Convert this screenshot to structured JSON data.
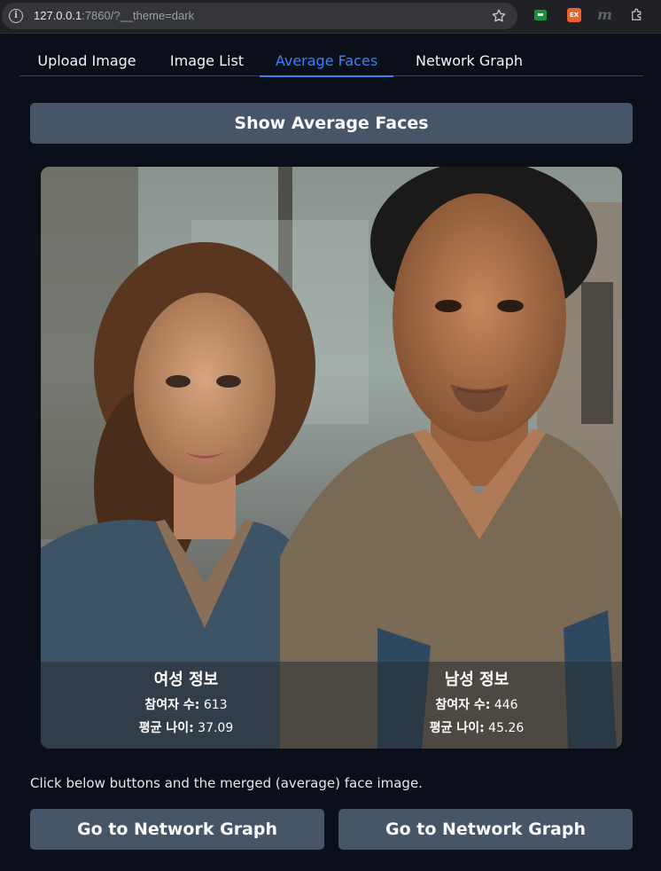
{
  "browser": {
    "url_host": "127.0.0.1",
    "url_rest": ":7860/?__theme=dark",
    "extension_badge": "EX",
    "extension_letter": "m"
  },
  "tabs": [
    {
      "label": "Upload Image",
      "active": false
    },
    {
      "label": "Image List",
      "active": false
    },
    {
      "label": "Average Faces",
      "active": true
    },
    {
      "label": "Network Graph",
      "active": false
    }
  ],
  "main": {
    "show_button_label": "Show Average Faces",
    "female": {
      "title": "여성 정보",
      "participants_label": "참여자 수:",
      "participants_value": "613",
      "avg_age_label": "평균 나이:",
      "avg_age_value": "37.09"
    },
    "male": {
      "title": "남성 정보",
      "participants_label": "참여자 수:",
      "participants_value": "446",
      "avg_age_label": "평균 나이:",
      "avg_age_value": "45.26"
    },
    "caption": "Click below buttons and the merged (average) face image.",
    "buttons": [
      {
        "label": "Go to Network Graph"
      },
      {
        "label": "Go to Network Graph"
      }
    ]
  },
  "colors": {
    "background": "#0b0f19",
    "accent": "#3b82f6",
    "button": "#475569"
  }
}
